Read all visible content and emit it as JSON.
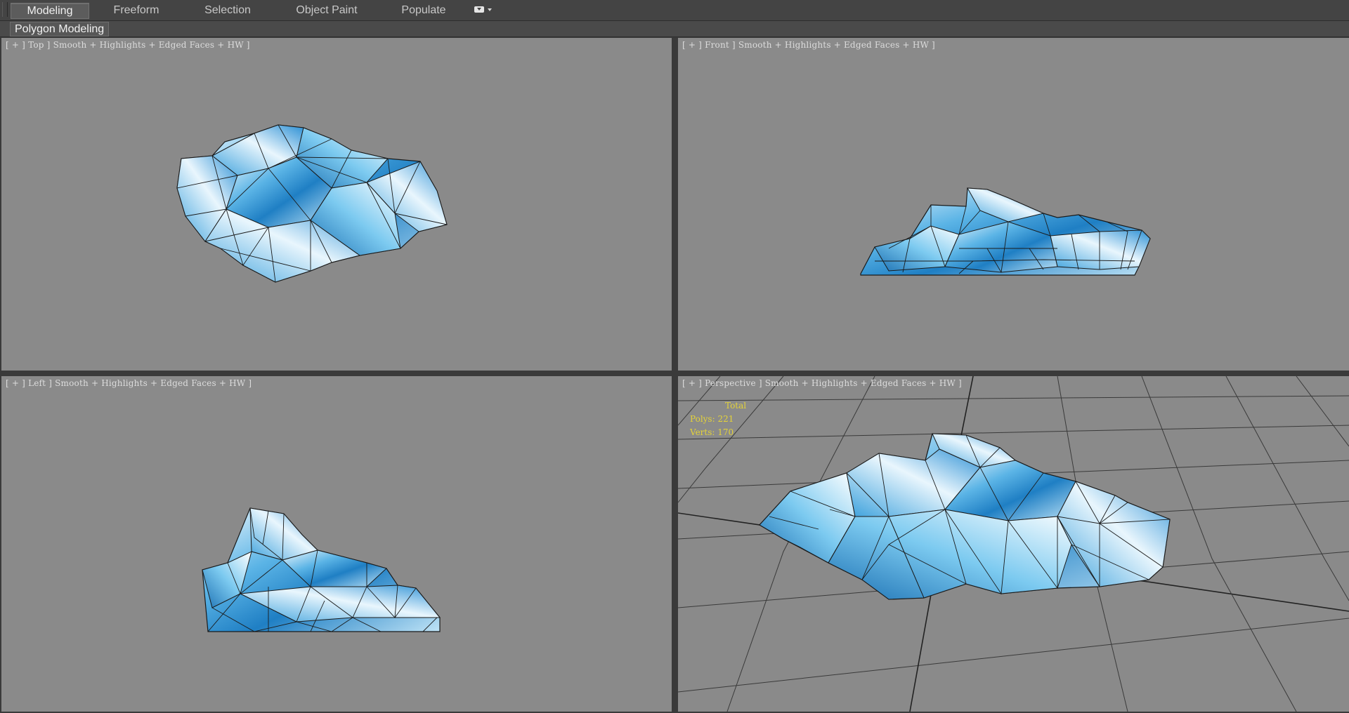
{
  "ribbon": {
    "tabs": [
      {
        "label": "Modeling",
        "active": true
      },
      {
        "label": "Freeform",
        "active": false
      },
      {
        "label": "Selection",
        "active": false
      },
      {
        "label": "Object Paint",
        "active": false
      },
      {
        "label": "Populate",
        "active": false
      }
    ],
    "more_icon": "dropdown-toggle-icon"
  },
  "subbar": {
    "active_panel": "Polygon Modeling"
  },
  "viewports": {
    "top": {
      "view": "Top",
      "shading": "Smooth + Highlights + Edged Faces + HW"
    },
    "front": {
      "view": "Front",
      "shading": "Smooth + Highlights + Edged Faces + HW"
    },
    "left": {
      "view": "Left",
      "shading": "Smooth + Highlights + Edged Faces + HW"
    },
    "perspective": {
      "view": "Perspective",
      "shading": "Smooth + Highlights + Edged Faces + HW"
    }
  },
  "stats": {
    "header": "Total",
    "polys_label": "Polys:",
    "polys": "221",
    "verts_label": "Verts:",
    "verts": "170"
  },
  "colors": {
    "viewport_bg": "#8a8a8a",
    "stats_text": "#e3d23a",
    "ice_light": "#e8f4fb",
    "ice_blue": "#3a9fd9",
    "ice_dark": "#1670b4",
    "wire": "#1a1a1a"
  }
}
